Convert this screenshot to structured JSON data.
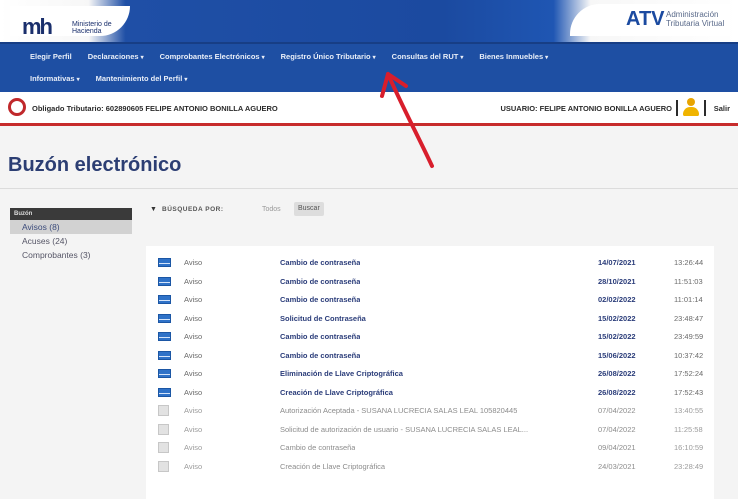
{
  "header": {
    "logo_mark": "mh",
    "logo_sub": "Ministerio de Hacienda",
    "atv_logo": "ATV",
    "atv_sub": "Administración Tributaria Virtual"
  },
  "nav": {
    "row1": [
      {
        "label": "Elegir Perfil",
        "dropdown": false
      },
      {
        "label": "Declaraciones",
        "dropdown": true
      },
      {
        "label": "Comprobantes Electrónicos",
        "dropdown": true
      },
      {
        "label": "Registro Único Tributario",
        "dropdown": true
      },
      {
        "label": "Consultas del RUT",
        "dropdown": true
      },
      {
        "label": "Bienes Inmuebles",
        "dropdown": true
      }
    ],
    "row2": [
      {
        "label": "Informativas",
        "dropdown": true
      },
      {
        "label": "Mantenimiento del Perfil",
        "dropdown": true
      }
    ]
  },
  "taxpayer": {
    "label": "Obligado Tributario: 602890605 FELIPE ANTONIO BONILLA AGUERO",
    "user_label": "USUARIO: FELIPE ANTONIO BONILLA AGUERO",
    "logout": "Salir"
  },
  "page_title": "Buzón electrónico",
  "sidebar": {
    "header": "Buzón",
    "items": [
      {
        "label": "Avisos (8)",
        "active": true
      },
      {
        "label": "Acuses (24)",
        "active": false
      },
      {
        "label": "Comprobantes (3)",
        "active": false
      }
    ]
  },
  "search": {
    "label": "BÚSQUEDA POR:",
    "selected": "Todos",
    "button": "Buscar"
  },
  "messages": [
    {
      "type": "Aviso",
      "subject": "Cambio de contraseña",
      "date": "14/07/2021",
      "time": "13:26:44",
      "read": false
    },
    {
      "type": "Aviso",
      "subject": "Cambio de contraseña",
      "date": "28/10/2021",
      "time": "11:51:03",
      "read": false
    },
    {
      "type": "Aviso",
      "subject": "Cambio de contraseña",
      "date": "02/02/2022",
      "time": "11:01:14",
      "read": false
    },
    {
      "type": "Aviso",
      "subject": "Solicitud de Contraseña",
      "date": "15/02/2022",
      "time": "23:48:47",
      "read": false
    },
    {
      "type": "Aviso",
      "subject": "Cambio de contraseña",
      "date": "15/02/2022",
      "time": "23:49:59",
      "read": false
    },
    {
      "type": "Aviso",
      "subject": "Cambio de contraseña",
      "date": "15/06/2022",
      "time": "10:37:42",
      "read": false
    },
    {
      "type": "Aviso",
      "subject": "Eliminación de Llave Criptográfica",
      "date": "26/08/2022",
      "time": "17:52:24",
      "read": false
    },
    {
      "type": "Aviso",
      "subject": "Creación de Llave Criptográfica",
      "date": "26/08/2022",
      "time": "17:52:43",
      "read": false
    },
    {
      "type": "Aviso",
      "subject": "Autorización Aceptada - SUSANA LUCRECIA SALAS LEAL 105820445",
      "date": "07/04/2022",
      "time": "13:40:55",
      "read": true
    },
    {
      "type": "Aviso",
      "subject": "Solicitud de autorización de usuario - SUSANA LUCRECIA SALAS LEAL...",
      "date": "07/04/2022",
      "time": "11:25:58",
      "read": true
    },
    {
      "type": "Aviso",
      "subject": "Cambio de contraseña",
      "date": "09/04/2021",
      "time": "16:10:59",
      "read": true
    },
    {
      "type": "Aviso",
      "subject": "Creación de Llave Criptográfica",
      "date": "24/03/2021",
      "time": "23:28:49",
      "read": true
    }
  ]
}
